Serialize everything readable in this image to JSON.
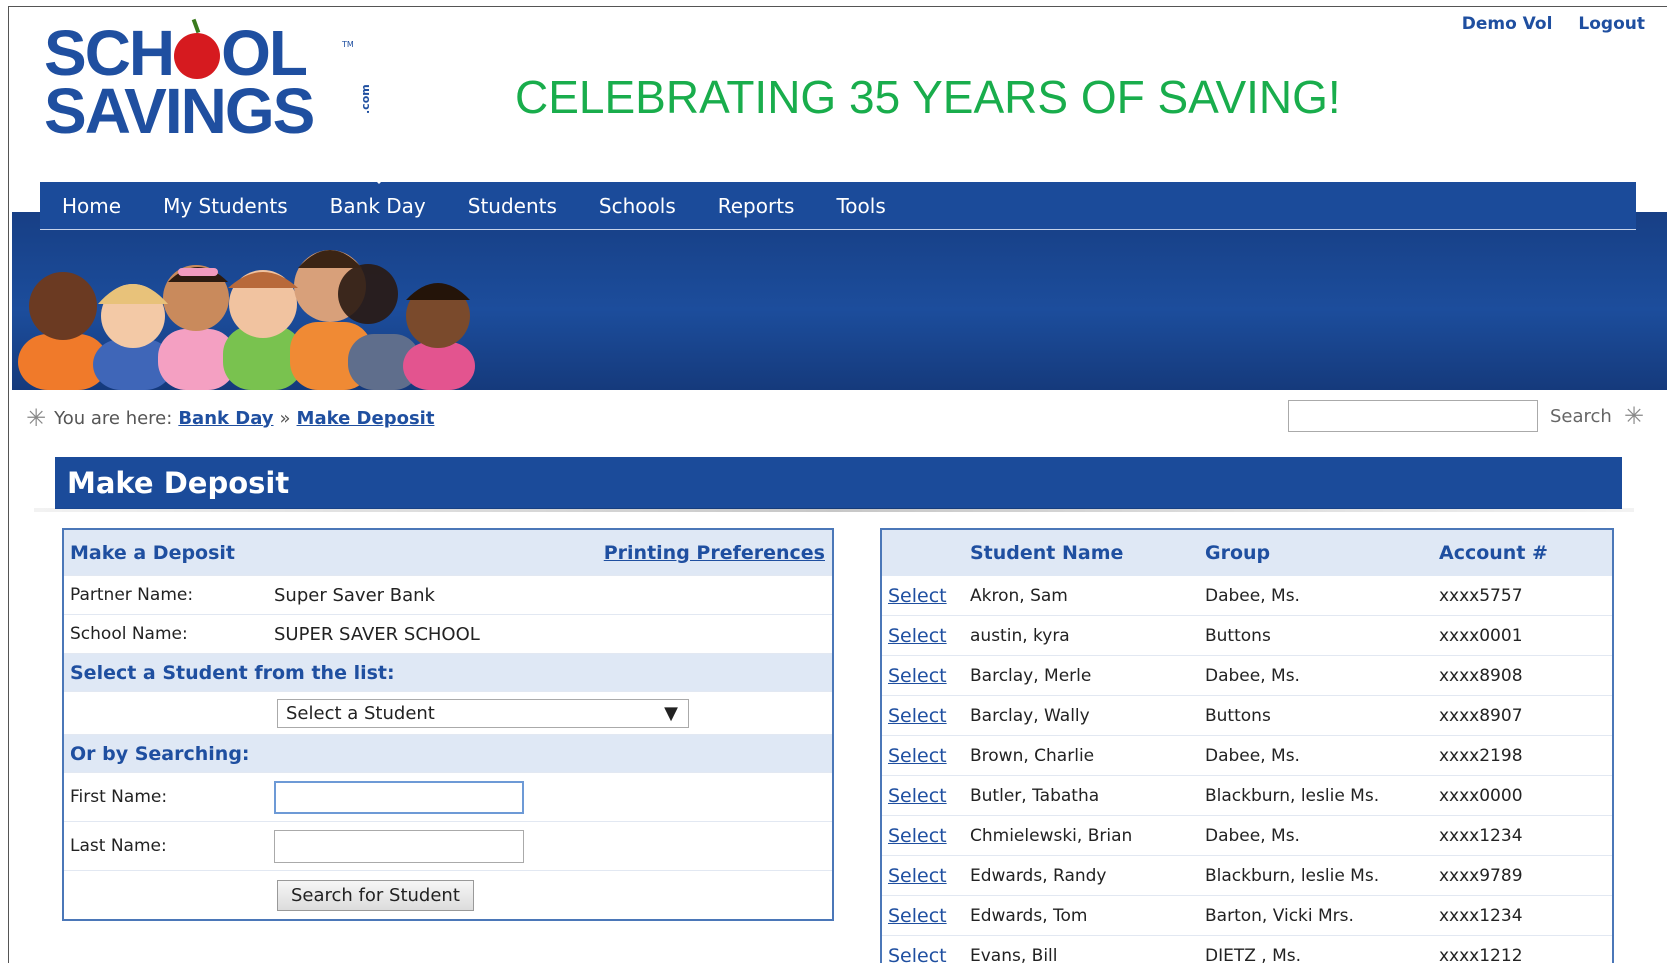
{
  "header": {
    "logo_line1": "SCH",
    "logo_line1_end": "OL",
    "logo_line2": "SAVINGS",
    "logo_com": ".com",
    "logo_tm": "TM",
    "tagline": "CELEBRATING 35 YEARS OF SAVING!",
    "user_link": "Demo Vol",
    "logout_link": "Logout"
  },
  "nav": {
    "items": [
      "Home",
      "My Students",
      "Bank Day",
      "Students",
      "Schools",
      "Reports",
      "Tools"
    ],
    "active": "Bank Day"
  },
  "breadcrumb": {
    "prefix": "You are here:",
    "items": [
      "Bank Day",
      "Make Deposit"
    ],
    "separator": "»"
  },
  "search": {
    "label": "Search",
    "value": ""
  },
  "section_title": "Make Deposit",
  "deposit_form": {
    "title": "Make a Deposit",
    "printing_link": "Printing Preferences",
    "partner_label": "Partner Name:",
    "partner_value": "Super Saver Bank",
    "school_label": "School Name:",
    "school_value": "SUPER SAVER SCHOOL",
    "select_heading": "Select a Student from the list:",
    "select_value": "Select a Student",
    "search_heading": "Or by Searching:",
    "first_name_label": "First Name:",
    "first_name_value": "",
    "last_name_label": "Last Name:",
    "last_name_value": "",
    "search_button": "Search for Student"
  },
  "student_table": {
    "columns": [
      "",
      "Student Name",
      "Group",
      "Account #"
    ],
    "select_label": "Select",
    "rows": [
      {
        "name": "Akron, Sam",
        "group": "Dabee, Ms.",
        "account": "xxxx5757"
      },
      {
        "name": "austin, kyra",
        "group": "Buttons",
        "account": "xxxx0001"
      },
      {
        "name": "Barclay, Merle",
        "group": "Dabee, Ms.",
        "account": "xxxx8908"
      },
      {
        "name": "Barclay, Wally",
        "group": "Buttons",
        "account": "xxxx8907"
      },
      {
        "name": "Brown, Charlie",
        "group": "Dabee, Ms.",
        "account": "xxxx2198"
      },
      {
        "name": "Butler, Tabatha",
        "group": "Blackburn, leslie Ms.",
        "account": "xxxx0000"
      },
      {
        "name": "Chmielewski, Brian",
        "group": "Dabee, Ms.",
        "account": "xxxx1234"
      },
      {
        "name": "Edwards, Randy",
        "group": "Blackburn, leslie Ms.",
        "account": "xxxx9789"
      },
      {
        "name": "Edwards, Tom",
        "group": "Barton, Vicki Mrs.",
        "account": "xxxx1234"
      },
      {
        "name": "Evans, Bill",
        "group": "DIETZ , Ms.",
        "account": "xxxx1212"
      }
    ]
  },
  "colors": {
    "brand_blue": "#1b4b9a",
    "tagline_green": "#19ad4c",
    "header_row_bg": "#dfe8f5"
  }
}
